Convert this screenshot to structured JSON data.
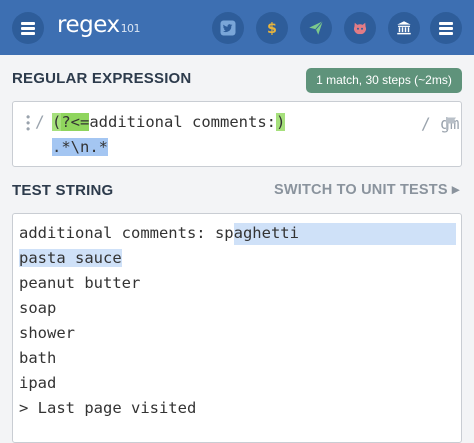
{
  "header": {
    "logo_text": "regex",
    "logo_version": "101",
    "icons": [
      "menu-icon",
      "twitter-icon",
      "dollar-icon",
      "send-icon",
      "github-icon",
      "bank-icon",
      "menu-icon"
    ]
  },
  "regex_section": {
    "title": "REGULAR EXPRESSION",
    "match_info": "1 match, 30 steps (~2ms)",
    "open_delimiter": "/",
    "close_delimiter": "/",
    "flags": "gm",
    "tokens": {
      "group_open": "(",
      "lookbehind": "?<=",
      "literal": "additional comments:",
      "group_close": ")",
      "line2": ".*\\n.*"
    }
  },
  "test_section": {
    "title": "TEST STRING",
    "switch_label": "SWITCH TO UNIT TESTS",
    "switch_arrow": "▸",
    "lines": {
      "l1a": "additional comments: ",
      "l1b": "spaghetti",
      "l2": "pasta sauce",
      "l3": "peanut butter",
      "l4": "soap",
      "l5": "shower",
      "l6": "bath",
      "l7": "ipad",
      "l8": "> Last page visited"
    }
  },
  "colors": {
    "header_bg": "#3d6fb2",
    "badge_bg": "#5f937b",
    "lookbehind_hl": "#8fd55d",
    "match_hl": "#cfe1f8"
  }
}
